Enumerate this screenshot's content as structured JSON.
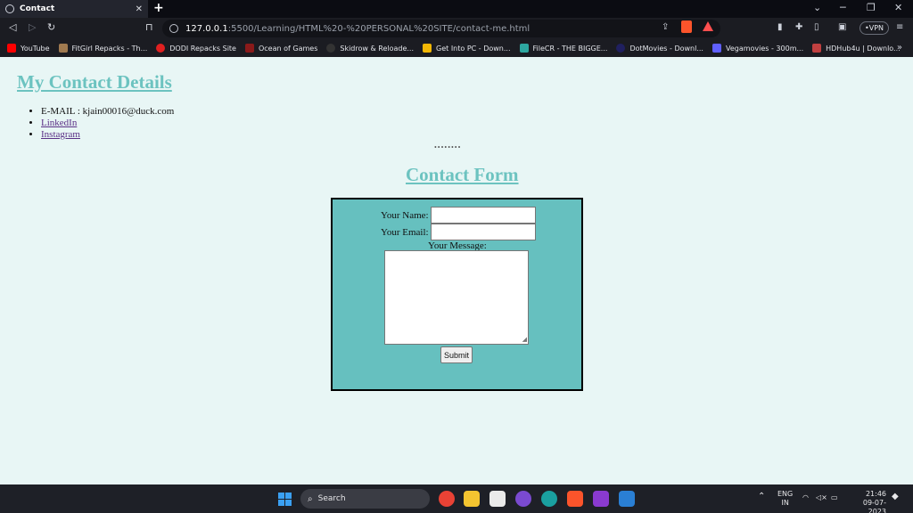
{
  "browser": {
    "tab_title": "Contact",
    "url_host": "127.0.0.1",
    "url_path": ":5500/Learning/HTML%20-%20PERSONAL%20SITE/contact-me.html",
    "vpn_label": "VPN",
    "bookmarks": [
      {
        "label": "YouTube",
        "color": "#ff0000"
      },
      {
        "label": "FitGirl Repacks - Th...",
        "color": "#a07a50"
      },
      {
        "label": "DODI Repacks Site",
        "color": "#e02020"
      },
      {
        "label": "Ocean of Games",
        "color": "#8b1a1a"
      },
      {
        "label": "Skidrow & Reloade...",
        "color": "#333333"
      },
      {
        "label": "Get Into PC - Down...",
        "color": "#f2b705"
      },
      {
        "label": "FileCR - THE BIGGE...",
        "color": "#2ea7a0"
      },
      {
        "label": "DotMovies - Downl...",
        "color": "#202060"
      },
      {
        "label": "Vegamovies - 300m...",
        "color": "#6060ff"
      },
      {
        "label": "HDHub4u | Downlo...",
        "color": "#c04040"
      }
    ]
  },
  "page": {
    "title": "My Contact Details",
    "contacts": [
      "E-MAIL : kjain00016@duck.com",
      "LinkedIn",
      "Instagram"
    ],
    "separator": "••••••••",
    "form_title": "Contact Form",
    "name_label": "Your Name:",
    "email_label": "Your Email:",
    "message_label": "Your Message:",
    "submit_label": "Submit"
  },
  "taskbar": {
    "search_label": "Search",
    "lang_top": "ENG",
    "lang_bottom": "IN",
    "time": "21:46",
    "date": "09-07-2023"
  }
}
